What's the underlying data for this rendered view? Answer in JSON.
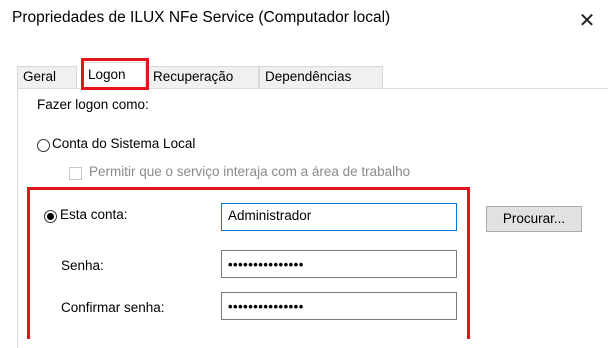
{
  "window": {
    "title": "Propriedades de ILUX NFe Service (Computador local)",
    "close_glyph": "✕"
  },
  "tabs": [
    {
      "label": "Geral",
      "active": false
    },
    {
      "label": "Logon",
      "active": true
    },
    {
      "label": "Recuperação",
      "active": false
    },
    {
      "label": "Dependências",
      "active": false
    }
  ],
  "logon": {
    "section_label": "Fazer logon como:",
    "local_system": {
      "label": "Conta do Sistema Local",
      "selected": false
    },
    "desktop_interact": {
      "label": "Permitir que o serviço interaja com a área de trabalho",
      "checked": false,
      "disabled": true
    },
    "this_account": {
      "label": "Esta conta:",
      "selected": true,
      "value": "Administrador"
    },
    "browse_button": "Procurar...",
    "password": {
      "label": "Senha:",
      "value": "•••••••••••••••"
    },
    "confirm_password": {
      "label": "Confirmar senha:",
      "value": "•••••••••••••••"
    }
  },
  "colors": {
    "highlight": "#e4141b",
    "focus_border": "#0078d7"
  }
}
